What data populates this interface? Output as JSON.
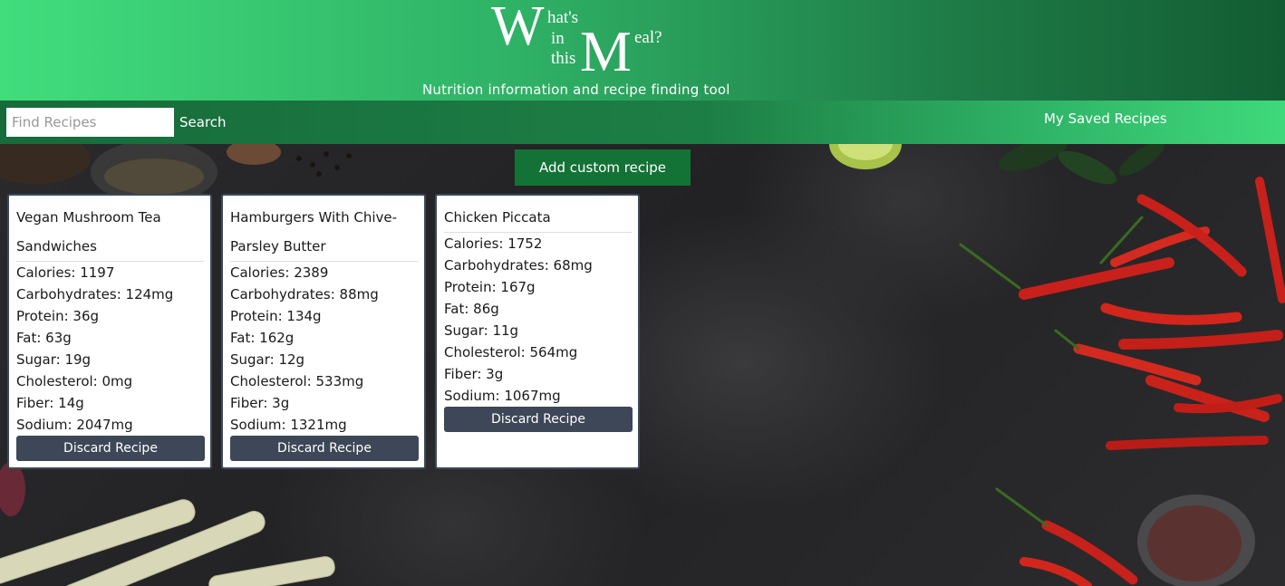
{
  "logo": {
    "big_w": "W",
    "small_1": "hat's",
    "small_2": "in",
    "small_3": "this",
    "big_m": "M",
    "small_4": "eal?"
  },
  "header": {
    "tagline": "Nutrition information and recipe finding tool"
  },
  "nav": {
    "search_placeholder": "Find Recipes",
    "search_value": "",
    "search_label": "Search",
    "saved_label": "My Saved Recipes"
  },
  "main": {
    "add_label": "Add custom recipe"
  },
  "recipes": [
    {
      "title": "Vegan Mushroom Tea Sandwiches",
      "calories": "Calories: 1197",
      "carbs": "Carbohydrates: 124mg",
      "protein": "Protein: 36g",
      "fat": "Fat: 63g",
      "sugar": "Sugar: 19g",
      "cholesterol": "Cholesterol: 0mg",
      "fiber": "Fiber: 14g",
      "sodium": "Sodium: 2047mg",
      "discard_label": "Discard Recipe"
    },
    {
      "title": "Hamburgers With Chive-Parsley Butter",
      "calories": "Calories: 2389",
      "carbs": "Carbohydrates: 88mg",
      "protein": "Protein: 134g",
      "fat": "Fat: 162g",
      "sugar": "Sugar: 12g",
      "cholesterol": "Cholesterol: 533mg",
      "fiber": "Fiber: 3g",
      "sodium": "Sodium: 1321mg",
      "discard_label": "Discard Recipe"
    },
    {
      "title": "Chicken Piccata",
      "calories": "Calories: 1752",
      "carbs": "Carbohydrates: 68mg",
      "protein": "Protein: 167g",
      "fat": "Fat: 86g",
      "sugar": "Sugar: 11g",
      "cholesterol": "Cholesterol: 564mg",
      "fiber": "Fiber: 3g",
      "sodium": "Sodium: 1067mg",
      "discard_label": "Discard Recipe"
    }
  ],
  "colors": {
    "header_green": "#41dd7d",
    "dark_green": "#137236",
    "card_border": "#3c4a5c",
    "button_slate": "#3d4757"
  },
  "background_image": "kitchen countertop with red chili peppers, spices, lime and lemongrass"
}
